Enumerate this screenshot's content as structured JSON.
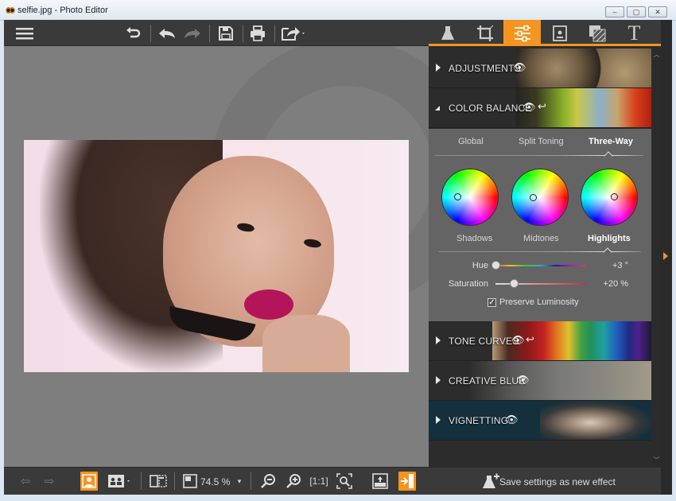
{
  "window": {
    "title": "selfie.jpg - Photo Editor",
    "controls": {
      "minimize": "‒",
      "maximize": "▢",
      "close": "✕"
    }
  },
  "toolbar": {
    "icons": [
      "menu-icon",
      "undo-all-icon",
      "undo-icon",
      "redo-icon",
      "save-icon",
      "print-icon",
      "export-icon"
    ]
  },
  "panel_tabs": [
    {
      "name": "effects",
      "icon": "flask-icon",
      "glyph": "⚗"
    },
    {
      "name": "crop",
      "icon": "crop-icon",
      "glyph": "⌗"
    },
    {
      "name": "adjust",
      "icon": "sliders-icon",
      "glyph": "☰",
      "active": true
    },
    {
      "name": "frames",
      "icon": "frame-icon",
      "glyph": "▣"
    },
    {
      "name": "textures",
      "icon": "texture-icon",
      "glyph": "▨"
    },
    {
      "name": "text",
      "icon": "text-icon",
      "glyph": "T"
    }
  ],
  "sections": [
    {
      "label": "ADJUSTMENTS",
      "expanded": false,
      "eye": true,
      "reset": false
    },
    {
      "label": "COLOR BALANCE",
      "expanded": true,
      "eye": true,
      "reset": true
    },
    {
      "label": "TONE CURVES",
      "expanded": false,
      "eye": true,
      "reset": true
    },
    {
      "label": "CREATIVE BLUR",
      "expanded": false,
      "eye": true,
      "reset": false
    },
    {
      "label": "VIGNETTING",
      "expanded": false,
      "eye": true,
      "reset": false
    }
  ],
  "color_balance": {
    "modes": [
      "Global",
      "Split Toning",
      "Three-Way"
    ],
    "active_mode": "Three-Way",
    "wheels": [
      "Shadows",
      "Midtones",
      "Highlights"
    ],
    "active_wheel": "Highlights",
    "hue": {
      "label": "Hue",
      "value": "+3 °",
      "value_num": 3,
      "fraction": 0.0
    },
    "saturation": {
      "label": "Saturation",
      "value": "+20 %",
      "value_num": 20,
      "fraction": 0.2
    },
    "preserve_luminosity": {
      "label": "Preserve Luminosity",
      "checked": true
    }
  },
  "bottombar": {
    "zoom": "74.5 %",
    "icons": [
      "prev-image-icon",
      "next-image-icon",
      "single-view-icon",
      "compare-view-icon",
      "split-view-icon",
      "fit-view-icon",
      "zoom-out-icon",
      "zoom-in-icon",
      "actual-size-icon",
      "zoom-fit-icon",
      "upload-icon",
      "exit-icon"
    ]
  },
  "save_effect": {
    "label": "Save settings as new effect"
  },
  "colors": {
    "accent": "#f5941f",
    "panel": "#2b2b2b",
    "canvas": "#7e7e7e"
  }
}
